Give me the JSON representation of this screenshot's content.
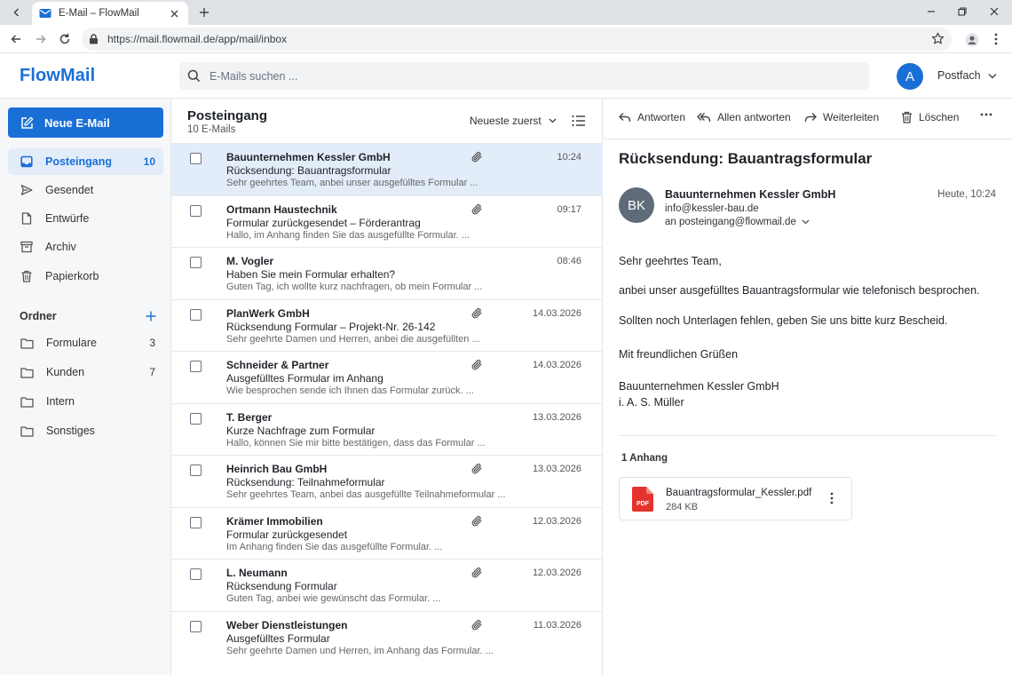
{
  "browser": {
    "tab_title": "E-Mail – FlowMail",
    "url": "https://mail.flowmail.de/app/mail/inbox"
  },
  "app": {
    "logo": "FlowMail",
    "search_placeholder": "E-Mails suchen ...",
    "avatar_initial": "A",
    "mailbox_label": "Postfach",
    "accent_color": "#1a6fd6"
  },
  "sidebar": {
    "compose_label": "Neue E-Mail",
    "items": [
      {
        "label": "Posteingang",
        "count": "10",
        "icon": "inbox-icon"
      },
      {
        "label": "Gesendet",
        "count": "",
        "icon": "send-icon"
      },
      {
        "label": "Entwürfe",
        "count": "",
        "icon": "draft-icon"
      },
      {
        "label": "Archiv",
        "count": "",
        "icon": "archive-icon"
      },
      {
        "label": "Papierkorb",
        "count": "",
        "icon": "trash-icon"
      }
    ],
    "folders_title": "Ordner",
    "folders": [
      {
        "label": "Formulare",
        "count": "3"
      },
      {
        "label": "Kunden",
        "count": "7"
      },
      {
        "label": "Intern",
        "count": ""
      },
      {
        "label": "Sonstiges",
        "count": ""
      }
    ]
  },
  "list": {
    "title": "Posteingang",
    "count_text": "10 E-Mails",
    "sort_label": "Neueste zuerst",
    "emails": [
      {
        "sender": "Bauunternehmen Kessler GmbH",
        "subject": "Rücksendung: Bauantragsformular",
        "preview": "Sehr geehrtes Team, anbei unser ausgefülltes Formular ...",
        "date": "10:24",
        "attachment": true,
        "selected": true
      },
      {
        "sender": "Ortmann Haustechnik",
        "subject": "Formular zurückgesendet – Förderantrag",
        "preview": "Hallo, im Anhang finden Sie das ausgefüllte Formular. ...",
        "date": "09:17",
        "attachment": true,
        "selected": false
      },
      {
        "sender": "M. Vogler",
        "subject": "Haben Sie mein Formular erhalten?",
        "preview": "Guten Tag, ich wollte kurz nachfragen, ob mein Formular ...",
        "date": "08:46",
        "attachment": false,
        "selected": false
      },
      {
        "sender": "PlanWerk GmbH",
        "subject": "Rücksendung Formular – Projekt-Nr. 26-142",
        "preview": "Sehr geehrte Damen und Herren, anbei die ausgefüllten ...",
        "date": "14.03.2026",
        "attachment": true,
        "selected": false
      },
      {
        "sender": "Schneider & Partner",
        "subject": "Ausgefülltes Formular im Anhang",
        "preview": "Wie besprochen sende ich Ihnen das Formular zurück. ...",
        "date": "14.03.2026",
        "attachment": true,
        "selected": false
      },
      {
        "sender": "T. Berger",
        "subject": "Kurze Nachfrage zum Formular",
        "preview": "Hallo, können Sie mir bitte bestätigen, dass das Formular ...",
        "date": "13.03.2026",
        "attachment": false,
        "selected": false
      },
      {
        "sender": "Heinrich Bau GmbH",
        "subject": "Rücksendung: Teilnahmeformular",
        "preview": "Sehr geehrtes Team, anbei das ausgefüllte Teilnahmeformular ...",
        "date": "13.03.2026",
        "attachment": true,
        "selected": false
      },
      {
        "sender": "Krämer Immobilien",
        "subject": "Formular zurückgesendet",
        "preview": "Im Anhang finden Sie das ausgefüllte Formular. ...",
        "date": "12.03.2026",
        "attachment": true,
        "selected": false
      },
      {
        "sender": "L. Neumann",
        "subject": "Rücksendung Formular",
        "preview": "Guten Tag, anbei wie gewünscht das Formular. ...",
        "date": "12.03.2026",
        "attachment": true,
        "selected": false
      },
      {
        "sender": "Weber Dienstleistungen",
        "subject": "Ausgefülltes Formular",
        "preview": "Sehr geehrte Damen und Herren, im Anhang das Formular. ...",
        "date": "11.03.2026",
        "attachment": true,
        "selected": false
      }
    ]
  },
  "reader": {
    "toolbar": {
      "reply": "Antworten",
      "reply_all": "Allen antworten",
      "forward": "Weiterleiten",
      "delete": "Löschen"
    },
    "subject": "Rücksendung: Bauantragsformular",
    "avatar_initials": "BK",
    "from_name": "Bauunternehmen Kessler GmbH",
    "from_addr": "info@kessler-bau.de",
    "to_line": "an posteingang@flowmail.de",
    "time": "Heute, 10:24",
    "body": {
      "greeting": "Sehr geehrtes Team,",
      "line1": "anbei unser ausgefülltes Bauantragsformular wie telefonisch besprochen.",
      "line2": "Sollten noch Unterlagen fehlen, geben Sie uns bitte kurz Bescheid.",
      "closing": "Mit freundlichen Grüßen",
      "sig1": "Bauunternehmen Kessler GmbH",
      "sig2": "i. A. S. Müller"
    },
    "attachments_title": "1 Anhang",
    "attachment": {
      "icon_label": "PDF",
      "name": "Bauantragsformular_Kessler.pdf",
      "size": "284 KB"
    }
  }
}
